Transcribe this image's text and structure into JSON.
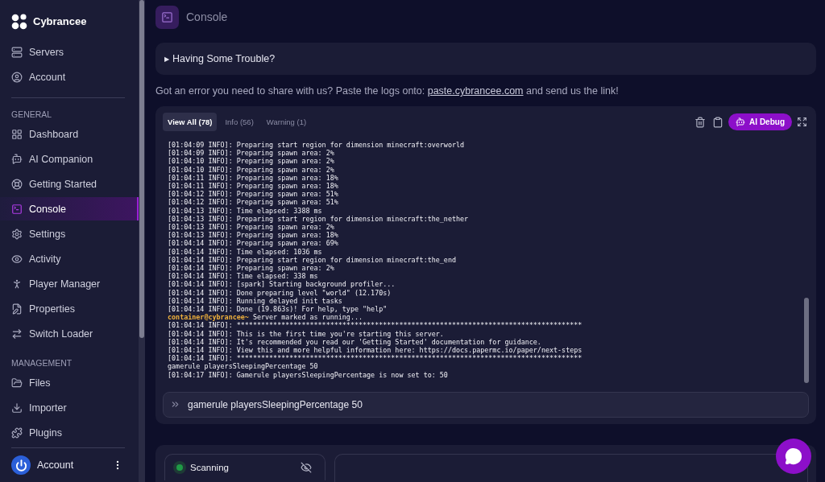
{
  "brand": {
    "name": "Cybrancee"
  },
  "sidebar": {
    "top_items": [
      {
        "label": "Servers",
        "selected": false
      },
      {
        "label": "Account",
        "selected": false
      }
    ],
    "sections": [
      {
        "heading": "GENERAL",
        "items": [
          {
            "label": "Dashboard",
            "selected": false
          },
          {
            "label": "AI Companion",
            "selected": false
          },
          {
            "label": "Getting Started",
            "selected": false
          },
          {
            "label": "Console",
            "selected": true
          },
          {
            "label": "Settings",
            "selected": false
          },
          {
            "label": "Activity",
            "selected": false
          },
          {
            "label": "Player Manager",
            "selected": false
          },
          {
            "label": "Properties",
            "selected": false
          },
          {
            "label": "Switch Loader",
            "selected": false
          }
        ]
      },
      {
        "heading": "MANAGEMENT",
        "items": [
          {
            "label": "Files",
            "selected": false
          },
          {
            "label": "Importer",
            "selected": false
          },
          {
            "label": "Plugins",
            "selected": false
          }
        ]
      }
    ],
    "footer": {
      "label": "Account"
    }
  },
  "page": {
    "title": "Console"
  },
  "trouble": {
    "marker": "▶",
    "label": "Having Some Trouble?",
    "expanded": false
  },
  "notice": {
    "before": "Got an error you need to share with us? Paste the logs onto: ",
    "link": "paste.cybrancee.com",
    "after": " and send us the link!"
  },
  "console": {
    "tabs": [
      {
        "label": "View All (78)",
        "selected": true
      },
      {
        "label": "Info (56)",
        "selected": false
      },
      {
        "label": "Warning (1)",
        "selected": false
      }
    ],
    "ai_button": "AI Debug",
    "lines": [
      {
        "kind": "log",
        "text": "[01:04:09 INFO]: Preparing start region for dimension minecraft:overworld"
      },
      {
        "kind": "log",
        "text": "[01:04:09 INFO]: Preparing spawn area: 2%"
      },
      {
        "kind": "log",
        "text": "[01:04:10 INFO]: Preparing spawn area: 2%"
      },
      {
        "kind": "log",
        "text": "[01:04:10 INFO]: Preparing spawn area: 2%"
      },
      {
        "kind": "log",
        "text": "[01:04:11 INFO]: Preparing spawn area: 18%"
      },
      {
        "kind": "log",
        "text": "[01:04:11 INFO]: Preparing spawn area: 18%"
      },
      {
        "kind": "log",
        "text": "[01:04:12 INFO]: Preparing spawn area: 51%"
      },
      {
        "kind": "log",
        "text": "[01:04:12 INFO]: Preparing spawn area: 51%"
      },
      {
        "kind": "log",
        "text": "[01:04:13 INFO]: Time elapsed: 3388 ms"
      },
      {
        "kind": "log",
        "text": "[01:04:13 INFO]: Preparing start region for dimension minecraft:the_nether"
      },
      {
        "kind": "log",
        "text": "[01:04:13 INFO]: Preparing spawn area: 2%"
      },
      {
        "kind": "log",
        "text": "[01:04:13 INFO]: Preparing spawn area: 18%"
      },
      {
        "kind": "log",
        "text": "[01:04:14 INFO]: Preparing spawn area: 69%"
      },
      {
        "kind": "log",
        "text": "[01:04:14 INFO]: Time elapsed: 1036 ms"
      },
      {
        "kind": "log",
        "text": "[01:04:14 INFO]: Preparing start region for dimension minecraft:the_end"
      },
      {
        "kind": "log",
        "text": "[01:04:14 INFO]: Preparing spawn area: 2%"
      },
      {
        "kind": "log",
        "text": "[01:04:14 INFO]: Time elapsed: 338 ms"
      },
      {
        "kind": "log",
        "text": "[01:04:14 INFO]: [spark] Starting background profiler..."
      },
      {
        "kind": "log",
        "text": "[01:04:14 INFO]: Done preparing level \"world\" (12.170s)"
      },
      {
        "kind": "log",
        "text": "[01:04:14 INFO]: Running delayed init tasks"
      },
      {
        "kind": "log",
        "text": "[01:04:14 INFO]: Done (19.863s)! For help, type \"help\""
      },
      {
        "kind": "prompt",
        "prefix": "container@cybrancee~",
        "text": " Server marked as running..."
      },
      {
        "kind": "log",
        "text": "[01:04:14 INFO]: *************************************************************************************"
      },
      {
        "kind": "log",
        "text": "[01:04:14 INFO]: This is the first time you're starting this server."
      },
      {
        "kind": "log",
        "text": "[01:04:14 INFO]: It's recommended you read our 'Getting Started' documentation for guidance."
      },
      {
        "kind": "log",
        "text": "[01:04:14 INFO]: View this and more helpful information here: https://docs.papermc.io/paper/next-steps"
      },
      {
        "kind": "log",
        "text": "[01:04:14 INFO]: *************************************************************************************"
      },
      {
        "kind": "log",
        "text": "gamerule playersSleepingPercentage 50"
      },
      {
        "kind": "log",
        "text": "[01:04:17 INFO]: Gamerule playersSleepingPercentage is now set to: 50"
      }
    ],
    "input": {
      "value": "gamerule playersSleepingPercentage 50"
    }
  },
  "status": {
    "label": "Scanning",
    "color": "#1f9a46"
  }
}
